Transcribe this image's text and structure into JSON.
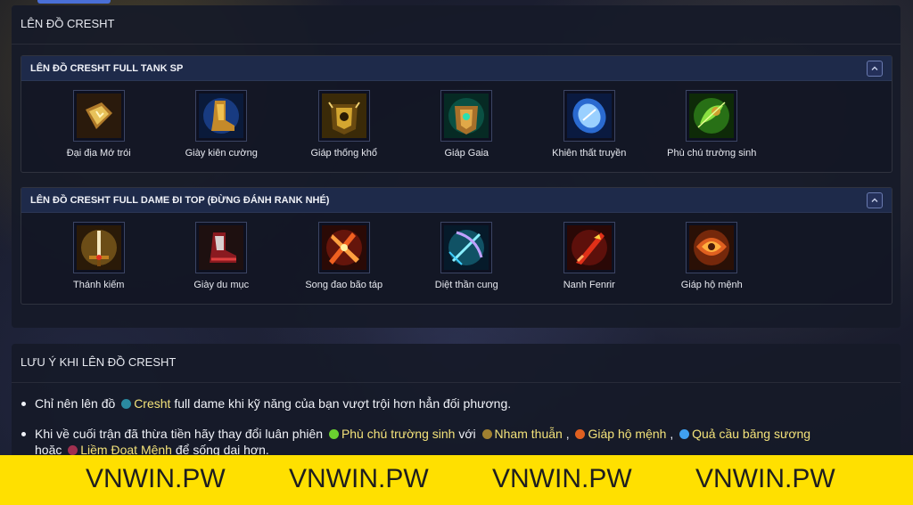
{
  "panel_builds": {
    "title": "LÊN ĐỒ CRESHT",
    "builds": [
      {
        "title": "LÊN ĐỒ CRESHT FULL TANK SP",
        "items": [
          {
            "name": "Đại địa Mớ trói",
            "icon": "golden-tome-icon"
          },
          {
            "name": "Giày kiên cường",
            "icon": "golden-boots-icon"
          },
          {
            "name": "Giáp thống khổ",
            "icon": "spiked-armor-icon"
          },
          {
            "name": "Giáp Gaia",
            "icon": "gaia-armor-icon"
          },
          {
            "name": "Khiên thất truyền",
            "icon": "ice-shield-icon"
          },
          {
            "name": "Phù chú trường sinh",
            "icon": "green-amulet-icon"
          }
        ]
      },
      {
        "title": "LÊN ĐỒ CRESHT FULL DAME ĐI TOP (ĐỪNG ĐÁNH RANK NHÉ)",
        "items": [
          {
            "name": "Thánh kiếm",
            "icon": "holy-sword-icon"
          },
          {
            "name": "Giày du mục",
            "icon": "red-boots-icon"
          },
          {
            "name": "Song đao bão táp",
            "icon": "twin-blades-icon"
          },
          {
            "name": "Diệt thần cung",
            "icon": "god-bow-icon"
          },
          {
            "name": "Nanh Fenrir",
            "icon": "fenrir-fang-icon"
          },
          {
            "name": "Giáp hộ mệnh",
            "icon": "guardian-armor-icon"
          }
        ]
      }
    ]
  },
  "panel_tips": {
    "title": "LƯU Ý KHI LÊN ĐỒ CRESHT",
    "tip1": {
      "prefix": "Chỉ nên lên đồ",
      "hero": "Cresht",
      "suffix": "full dame khi kỹ năng của bạn vượt trội hơn hẳn đối phương."
    },
    "tip2": {
      "prefix": "Khi về cuối trận đã thừa tiền hãy thay đổi luân phiên",
      "item1": "Phù chú trường sinh",
      "with": "với",
      "item2": "Nham thuẫn",
      "sep1": ",",
      "item3": "Giáp hộ mệnh",
      "sep2": ",",
      "item4": "Quả cầu băng sương",
      "line2_prefix": "hoặc",
      "item5": "Liềm Đoạt Mệnh",
      "line2_suffix": "để sống dai hơn."
    }
  },
  "banner": {
    "texts": [
      "VNWIN.PW",
      "VNWIN.PW",
      "VNWIN.PW",
      "VNWIN.PW"
    ],
    "color": "#ffe000"
  },
  "colors": {
    "accent": "#4a6fd6",
    "highlight": "#f3e27a"
  }
}
